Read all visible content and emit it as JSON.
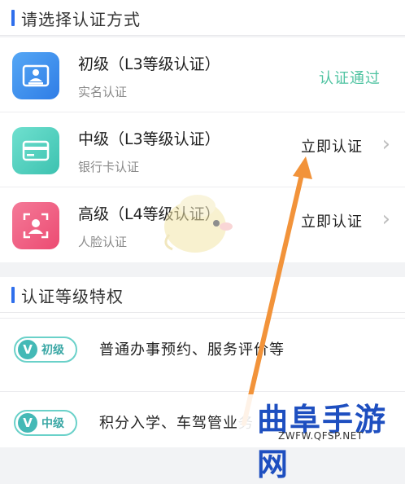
{
  "auth_section": {
    "title": "请选择认证方式",
    "options": [
      {
        "title": "初级（L3等级认证）",
        "subtitle": "实名认证",
        "status": "认证通过",
        "icon": "id-card-icon",
        "color": "#3b8ff0"
      },
      {
        "title": "中级（L3等级认证）",
        "subtitle": "银行卡认证",
        "action": "立即认证",
        "icon": "bank-card-icon",
        "color": "#4fd1c0"
      },
      {
        "title": "高级（L4等级认证）",
        "subtitle": "人脸认证",
        "action": "立即认证",
        "icon": "face-scan-icon",
        "color": "#f0587e"
      }
    ]
  },
  "perks_section": {
    "title": "认证等级特权",
    "items": [
      {
        "badge_letter": "V",
        "badge_level": "初级",
        "text": "普通办事预约、服务评价等"
      },
      {
        "badge_letter": "V",
        "badge_level": "中级",
        "text": "积分入学、车驾管业务"
      }
    ]
  },
  "watermark": {
    "brand": "曲阜手游网",
    "url": "ZWFW.QFSP.NET"
  },
  "colors": {
    "accent": "#2f6fec",
    "success": "#4fc3a1",
    "arrow": "#f2933a"
  }
}
